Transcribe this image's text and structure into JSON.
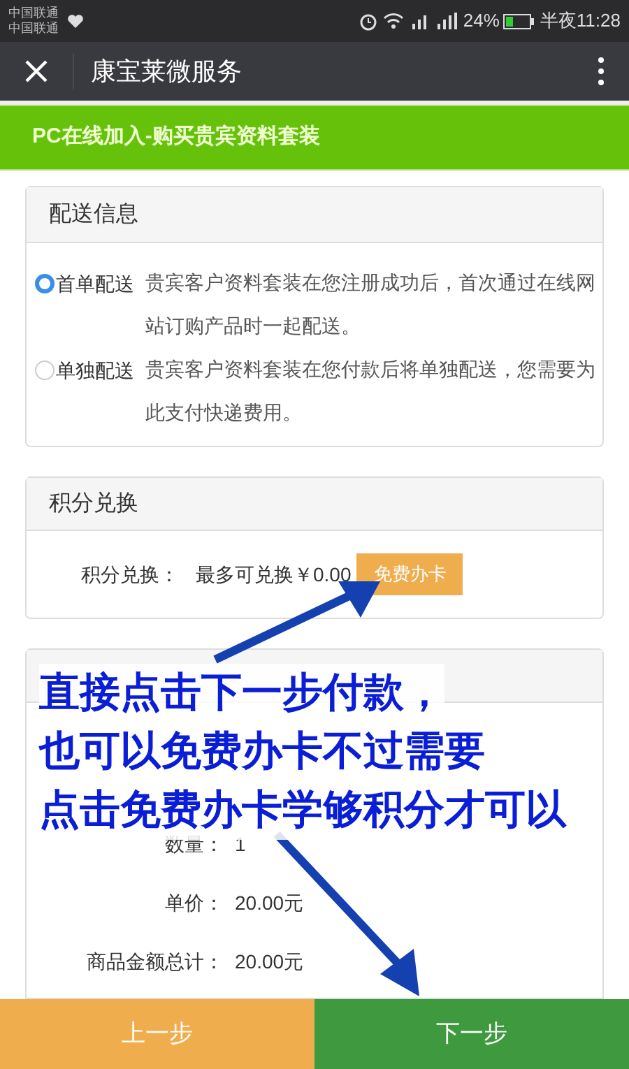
{
  "status_bar": {
    "carriers": [
      "中国联通",
      "中国联通"
    ],
    "battery": "24%",
    "time": "半夜11:28"
  },
  "title_bar": {
    "title": "康宝莱微服务"
  },
  "banner": {
    "title": "PC在线加入-购买贵宾资料套装"
  },
  "delivery": {
    "title": "配送信息",
    "options": [
      {
        "label": "首单配送",
        "description": "贵宾客户资料套装在您注册成功后，首次通过在线网站订购产品时一起配送。",
        "selected": true
      },
      {
        "label": "单独配送",
        "description": "贵宾客户资料套装在您付款后将单独配送，您需要为此支付快递费用。",
        "selected": false
      }
    ]
  },
  "points": {
    "title": "积分兑换",
    "label": "积分兑换：",
    "value": "最多可兑换￥0.00",
    "button": "免费办卡"
  },
  "products": {
    "rows": [
      {
        "label": "数量：",
        "value": "1"
      },
      {
        "label": "单价：",
        "value": "20.00元"
      },
      {
        "label": "商品金额总计：",
        "value": "20.00元"
      }
    ]
  },
  "annotation": {
    "lines": [
      "直接点击下一步付款，",
      "也可以免费办卡不过需要",
      "点击免费办卡学够积分才可以"
    ]
  },
  "footer": {
    "prev": "上一步",
    "next": "下一步"
  }
}
